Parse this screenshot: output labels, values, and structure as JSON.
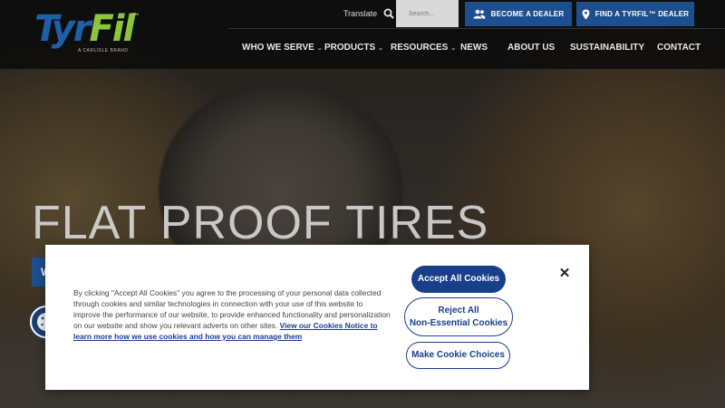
{
  "brand": {
    "logo_text_1": "Tyr",
    "logo_text_2": "Fil",
    "logo_tm": "™",
    "logo_sub": "A CARLISLE BRAND"
  },
  "utility": {
    "translate_label": "Translate",
    "search_placeholder": "Search...",
    "become_dealer": "BECOME A DEALER",
    "find_dealer": "FIND A TYRFIL™ DEALER"
  },
  "nav": {
    "items": [
      {
        "label": "WHO WE SERVE"
      },
      {
        "label": "PRODUCTS"
      },
      {
        "label": "RESOURCES"
      },
      {
        "label": "NEWS"
      },
      {
        "label": "ABOUT US"
      },
      {
        "label": "SUSTAINABILITY"
      },
      {
        "label": "CONTACT"
      }
    ]
  },
  "hero": {
    "title": "FLAT PROOF TIRES",
    "cta_partial": "W"
  },
  "cookie": {
    "text": "By clicking \"Accept All Cookies\" you agree to the processing of your personal data collected through cookies and similar technologies in connection with your use of this website to improve the performance of our website, to provide enhanced functionality and personalization on our website and show you relevant adverts on other sites.",
    "link": "View our Cookies Notice to learn more how we use cookies and how you can manage them",
    "accept": "Accept All Cookies",
    "reject_line1": "Reject All",
    "reject_line2": "Non-Essential Cookies",
    "choices": "Make Cookie Choices",
    "close": "✕"
  },
  "colors": {
    "brand_blue": "#1d4f8f",
    "brand_green": "#8cc63f",
    "cookie_blue": "#193f8a"
  }
}
